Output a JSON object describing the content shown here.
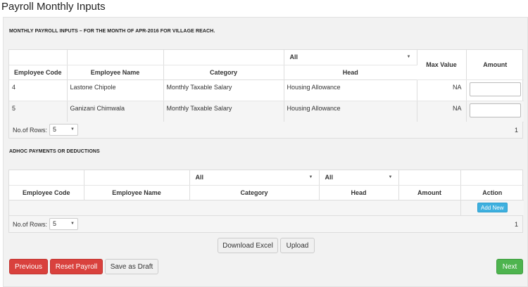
{
  "page": {
    "title": "Payroll Monthly Inputs"
  },
  "monthly": {
    "section_title": "MONTHLY PAYROLL INPUTS – FOR THE MONTH OF APR-2016 FOR VILLAGE REACH.",
    "head_filter": "All",
    "columns": [
      "Employee Code",
      "Employee Name",
      "Category",
      "Head",
      "Max Value",
      "Amount"
    ],
    "rows": [
      {
        "code": "4",
        "name": "Lastone Chipole",
        "category": "Monthly Taxable Salary",
        "head": "Housing Allowance",
        "max_value": "NA",
        "amount": ""
      },
      {
        "code": "5",
        "name": "Ganizani Chimwala",
        "category": "Monthly Taxable Salary",
        "head": "Housing Allowance",
        "max_value": "NA",
        "amount": ""
      }
    ],
    "pager": {
      "label": "No.of Rows:",
      "rows_value": "5",
      "page": "1"
    }
  },
  "adhoc": {
    "section_title": "ADHOC PAYMENTS OR DEDUCTIONS",
    "category_filter": "All",
    "head_filter": "All",
    "columns": [
      "Employee Code",
      "Employee Name",
      "Category",
      "Head",
      "Amount",
      "Action"
    ],
    "add_new_label": "Add New",
    "pager": {
      "label": "No.of Rows:",
      "rows_value": "5",
      "page": "1"
    }
  },
  "buttons": {
    "download_excel": "Download Excel",
    "upload": "Upload",
    "previous": "Previous",
    "reset_payroll": "Reset Payroll",
    "save_draft": "Save as Draft",
    "next": "Next"
  },
  "colors": {
    "danger": "#d9413d",
    "success": "#4eb44f",
    "info": "#3eb0df"
  },
  "icons": {
    "dropdown": "caret-down-icon"
  }
}
